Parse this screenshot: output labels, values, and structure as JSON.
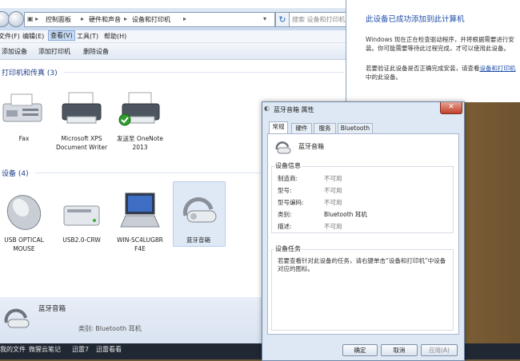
{
  "explorer": {
    "breadcrumb": [
      "控制面板",
      "硬件和声音",
      "设备和打印机"
    ],
    "search_placeholder": "搜索 设备和打印机",
    "menu": [
      "文件(F)",
      "编辑(E)",
      "查看(V)",
      "工具(T)",
      "帮助(H)"
    ],
    "commands": [
      "添加设备",
      "添加打印机",
      "删除设备"
    ],
    "printers_group": "打印机和传真 (3)",
    "printers": [
      {
        "label": "Fax"
      },
      {
        "label": "Microsoft XPS Document Writer"
      },
      {
        "label": "发送至 OneNote 2013"
      }
    ],
    "devices_group": "设备 (4)",
    "devices": [
      {
        "label": "USB OPTICAL MOUSE"
      },
      {
        "label": "USB2.0-CRW"
      },
      {
        "label": "WIN-SC4LUG8R F4E"
      },
      {
        "label": "蓝牙音箱"
      }
    ],
    "details": {
      "name": "蓝牙音箱",
      "category": "类别: Bluetooth 耳机"
    }
  },
  "taskbar": {
    "items": [
      "我的文件",
      "微猩云笔记",
      "迅雷7",
      "迅雷看看"
    ]
  },
  "popup": {
    "title": "此设备已成功添加到此计算机",
    "para1": "Windows 现在正在检查驱动程序，并将根据需要进行安装。你可能需要等待此过程完成，才可以使用此设备。",
    "para2_prefix": "若要验证此设备是否正确完成安装，请查看",
    "para2_link": "设备和打印机",
    "para2_suffix": "中的此设备。"
  },
  "dialog": {
    "title": "蓝牙音箱 属性",
    "close": "✕",
    "tabs": [
      "常规",
      "硬件",
      "服务",
      "Bluetooth"
    ],
    "device_name": "蓝牙音箱",
    "info_title": "设备信息",
    "info_rows": [
      {
        "label": "制造商:",
        "value": "不可用"
      },
      {
        "label": "型号:",
        "value": "不可用"
      },
      {
        "label": "型号编码:",
        "value": "不可用"
      },
      {
        "label": "类别:",
        "value": "Bluetooth 耳机"
      },
      {
        "label": "描述:",
        "value": "不可用"
      }
    ],
    "tasks_title": "设备任务",
    "tasks_text": "若要查看针对此设备的任务，请右键单击“设备和打印机”中设备对应的图标。",
    "buttons": {
      "ok": "确定",
      "cancel": "取消",
      "apply": "应用(A)"
    }
  },
  "colors": {
    "accent": "#1f4da8",
    "selection": "#dfe9f6"
  }
}
